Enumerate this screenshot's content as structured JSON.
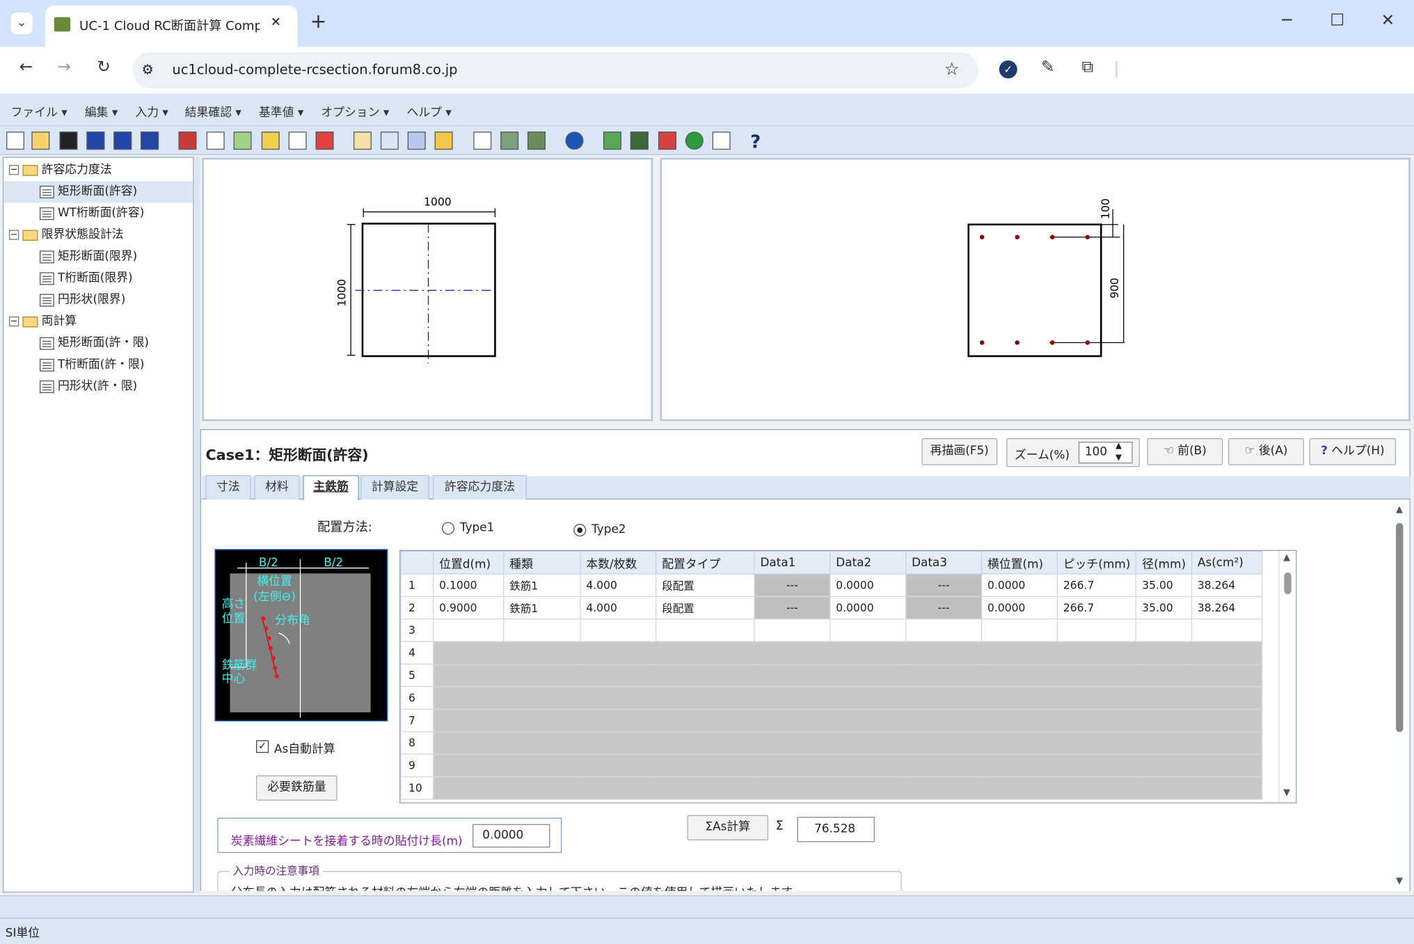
{
  "browser": {
    "tab_title": "UC-1 Cloud RC断面計算 Compl",
    "new_tab": "+",
    "url": "uc1cloud-complete-rcsection.forum8.co.jp",
    "win_min": "─",
    "win_max": "☐",
    "win_close": "✕"
  },
  "menu": [
    "ファイル ▾",
    "編集 ▾",
    "入力 ▾",
    "結果確認 ▾",
    "基準値 ▾",
    "オプション ▾",
    "ヘルプ ▾"
  ],
  "tree": {
    "groups": [
      {
        "label": "許容応力度法",
        "items": [
          "矩形断面(許容)",
          "WT桁断面(許容)"
        ]
      },
      {
        "label": "限界状態設計法",
        "items": [
          "矩形断面(限界)",
          "T桁断面(限界)",
          "円形状(限界)"
        ]
      },
      {
        "label": "両計算",
        "items": [
          "矩形断面(許・限)",
          "T桁断面(許・限)",
          "円形状(許・限)"
        ]
      }
    ]
  },
  "drawing_left": {
    "width_dim": "1000",
    "height_dim": "1000"
  },
  "drawing_right": {
    "top_dim": "100",
    "side_dim": "900"
  },
  "section": {
    "title": "Case1：矩形断面(許容)",
    "redraw": "再描画(F5)",
    "zoom_label": "ズーム(%)",
    "zoom_value": "100",
    "prev": "前(B)",
    "next": "後(A)",
    "help": "ヘルプ(H)",
    "tabs": [
      "寸法",
      "材料",
      "主鉄筋",
      "計算設定",
      "許容応力度法"
    ],
    "placement_label": "配置方法:",
    "type1": "Type1",
    "type2": "Type2",
    "diagram": {
      "b_half_left": "B/2",
      "b_half_right": "B/2",
      "horiz_pos": "横位置",
      "left_side": "(左側⊖)",
      "height_pos": "高さ",
      "pos": "位置",
      "dist_angle": "分布角",
      "rebar_group": "鉄筋群",
      "center": "中心"
    },
    "as_auto": "As自動計算",
    "required_rebar": "必要鉄筋量",
    "sum_button": "ΣAs計算",
    "sigma": "Σ",
    "sum_value": "76.528",
    "carbon_label": "炭素繊維シートを接着する時の貼付け長(m)",
    "carbon_value": "0.0000",
    "notes_title": "入力時の注意事項",
    "notes_text": "分布長の入力は配筋される材料の左端から右端の距離を入力して下さい。この値を使用して描画いたします。"
  },
  "grid": {
    "headers": [
      "位置d(m)",
      "種類",
      "本数/枚数",
      "配置タイプ",
      "Data1",
      "Data2",
      "Data3",
      "横位置(m)",
      "ピッチ(mm)",
      "径(mm)",
      "As(cm²)"
    ],
    "rows": [
      [
        "1",
        "0.1000",
        "鉄筋1",
        "4.000",
        "段配置",
        "---",
        "0.0000",
        "---",
        "0.0000",
        "266.7",
        "35.00",
        "38.264"
      ],
      [
        "2",
        "0.9000",
        "鉄筋1",
        "4.000",
        "段配置",
        "---",
        "0.0000",
        "---",
        "0.0000",
        "266.7",
        "35.00",
        "38.264"
      ],
      [
        "3",
        "",
        "",
        "",
        "",
        "",
        "",
        "",
        "",
        "",
        "",
        ""
      ],
      [
        "4"
      ],
      [
        "5"
      ],
      [
        "6"
      ],
      [
        "7"
      ],
      [
        "8"
      ],
      [
        "9"
      ],
      [
        "10"
      ]
    ]
  },
  "status": {
    "unit": "SI単位"
  }
}
